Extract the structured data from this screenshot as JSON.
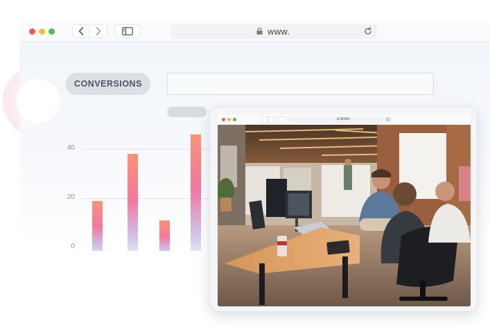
{
  "browser": {
    "url": "www.",
    "icons": {
      "back": "chevron-left-icon",
      "forward": "chevron-right-icon",
      "sidebar": "sidebar-icon",
      "lock": "lock-icon",
      "reload": "reload-icon"
    }
  },
  "dashboard": {
    "pill_label": "CONVERSIONS"
  },
  "chart_data": {
    "type": "bar",
    "categories": [
      "",
      "",
      "",
      ""
    ],
    "values": [
      19,
      38,
      11,
      46
    ],
    "title": "",
    "xlabel": "",
    "ylabel": "",
    "yticks": [
      0,
      20,
      40
    ],
    "ylim": [
      0,
      50
    ],
    "grid": true
  },
  "tablet": {
    "url": "a.www.",
    "image_subject": "office-team-meeting-photo"
  },
  "colors": {
    "bar_top": "#ff7f5c",
    "bar_mid": "#f1608e",
    "bar_bottom": "#e9e7f7",
    "traffic_red": "#f05a50",
    "traffic_yellow": "#f4bd3a",
    "traffic_green": "#49c354"
  }
}
